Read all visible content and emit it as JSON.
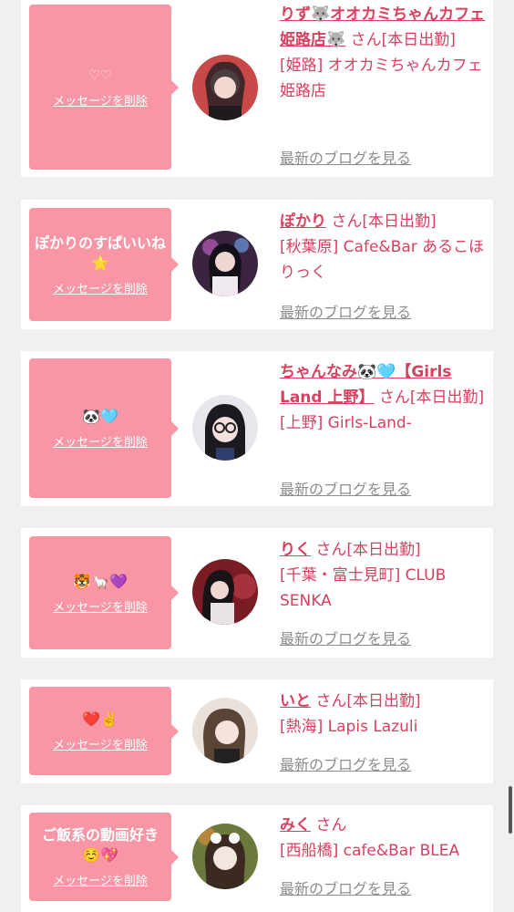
{
  "cards": [
    {
      "message": "♡♡",
      "delete_label": "メッセージを削除",
      "name": "りず🐺オオカミちゃんカフェ姫路店🐺",
      "suffix": "さん[本日出勤]",
      "shop": "[姫路] オオカミちゃんカフェ姫路店",
      "blog_label": "最新のブログを見る"
    },
    {
      "message": "ぽかりのすぱいいね⭐",
      "delete_label": "メッセージを削除",
      "name": "ぽかり",
      "suffix": "さん[本日出勤]",
      "shop": "[秋葉原] Cafe&Bar あるこほりっく",
      "blog_label": "最新のブログを見る"
    },
    {
      "message": "🐼🩵",
      "delete_label": "メッセージを削除",
      "name": "ちゃんなみ🐼🩵【Girls Land 上野】",
      "suffix": "さん[本日出勤]",
      "shop": "[上野] Girls-Land-",
      "blog_label": "最新のブログを見る"
    },
    {
      "message": "🐯🦙💜",
      "delete_label": "メッセージを削除",
      "name": "りく",
      "suffix": "さん[本日出勤]",
      "shop": "[千葉・富士見町] CLUB SENKA",
      "blog_label": "最新のブログを見る"
    },
    {
      "message": "❤️✌️",
      "delete_label": "メッセージを削除",
      "name": "いと",
      "suffix": "さん[本日出勤]",
      "shop": "[熱海] Lapis Lazuli",
      "blog_label": "最新のブログを見る"
    },
    {
      "message": "ご飯系の動画好き☺️💖",
      "delete_label": "メッセージを削除",
      "name": "みく",
      "suffix": "さん",
      "shop": "[西船橋] cafe&Bar BLEA",
      "blog_label": "最新のブログを見る"
    }
  ],
  "colors": {
    "background": "#f1eff0",
    "bubble": "#f996a6",
    "accent": "#d9405f",
    "link_gray": "#8c8c8c"
  }
}
